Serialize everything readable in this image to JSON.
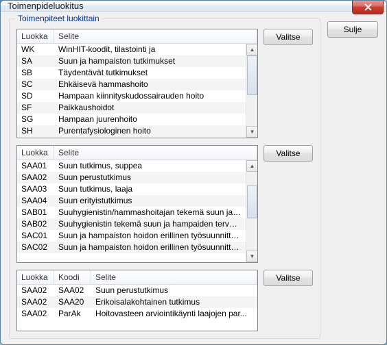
{
  "window": {
    "title": "Toimenpideluokitus"
  },
  "buttons": {
    "close": "Sulje",
    "select": "Valitse"
  },
  "groupbox": {
    "legend": "Toimenpiteet luokittain"
  },
  "columns": {
    "luokka": "Luokka",
    "koodi": "Koodi",
    "selite": "Selite"
  },
  "list1": [
    {
      "luokka": "WK",
      "selite": "WinHIT-koodit, tilastointi ja"
    },
    {
      "luokka": "SA",
      "selite": "Suun ja hampaiston tutkimukset"
    },
    {
      "luokka": "SB",
      "selite": "Täydentävät tutkimukset"
    },
    {
      "luokka": "SC",
      "selite": "Ehkäisevä hammashoito"
    },
    {
      "luokka": "SD",
      "selite": "Hampaan kiinnityskudossairauden hoito"
    },
    {
      "luokka": "SF",
      "selite": "Paikkaushoidot"
    },
    {
      "luokka": "SG",
      "selite": "Hampaan juurenhoito"
    },
    {
      "luokka": "SH",
      "selite": "Purentafysiologinen hoito"
    }
  ],
  "list2": [
    {
      "luokka": "SAA01",
      "selite": "Suun tutkimus, suppea"
    },
    {
      "luokka": "SAA02",
      "selite": "Suun perustutkimus"
    },
    {
      "luokka": "SAA03",
      "selite": "Suun tutkimus, laaja"
    },
    {
      "luokka": "SAA04",
      "selite": "Suun erityistutkimus"
    },
    {
      "luokka": "SAB01",
      "selite": "Suuhygienistin/hammashoitajan tekemä suun ja ha..."
    },
    {
      "luokka": "SAB02",
      "selite": "Suuhygienistin tekemä suun ja hampaiden terveystar"
    },
    {
      "luokka": "SAC01",
      "selite": "Suun ja hampaiston hoidon erillinen työsuunnittelu"
    },
    {
      "luokka": "SAC02",
      "selite": "Suun ja hampaiston hoidon erillinen työsuunnittelu"
    }
  ],
  "list3": [
    {
      "luokka": "SAA02",
      "koodi": "SAA02",
      "selite": "Suun perustutkimus"
    },
    {
      "luokka": "SAA02",
      "koodi": "SAA20",
      "selite": "Erikoisalakohtainen tutkimus"
    },
    {
      "luokka": "SAA02",
      "koodi": "ParAk",
      "selite": "Hoitovasteen arviointikäynti laajojen par..."
    }
  ]
}
